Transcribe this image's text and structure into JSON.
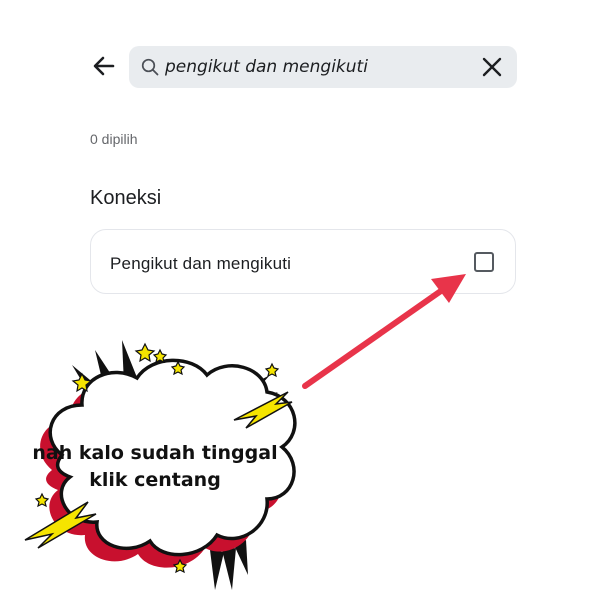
{
  "header": {
    "back_icon": "arrow-left-icon",
    "search": {
      "icon": "search-icon",
      "value": "pengikut dan mengikuti",
      "clear_icon": "close-icon"
    }
  },
  "selection": {
    "count_label": "0 dipilih"
  },
  "section": {
    "title": "Koneksi",
    "items": [
      {
        "label": "Pengikut dan mengikuti",
        "checked": false
      }
    ]
  },
  "annotation": {
    "line1": "nah kalo sudah tinggal",
    "line2": "klik centang",
    "arrow_color": "#e8344a",
    "cloud_shadow_color": "#c8102e",
    "accent_color": "#f5e400"
  }
}
